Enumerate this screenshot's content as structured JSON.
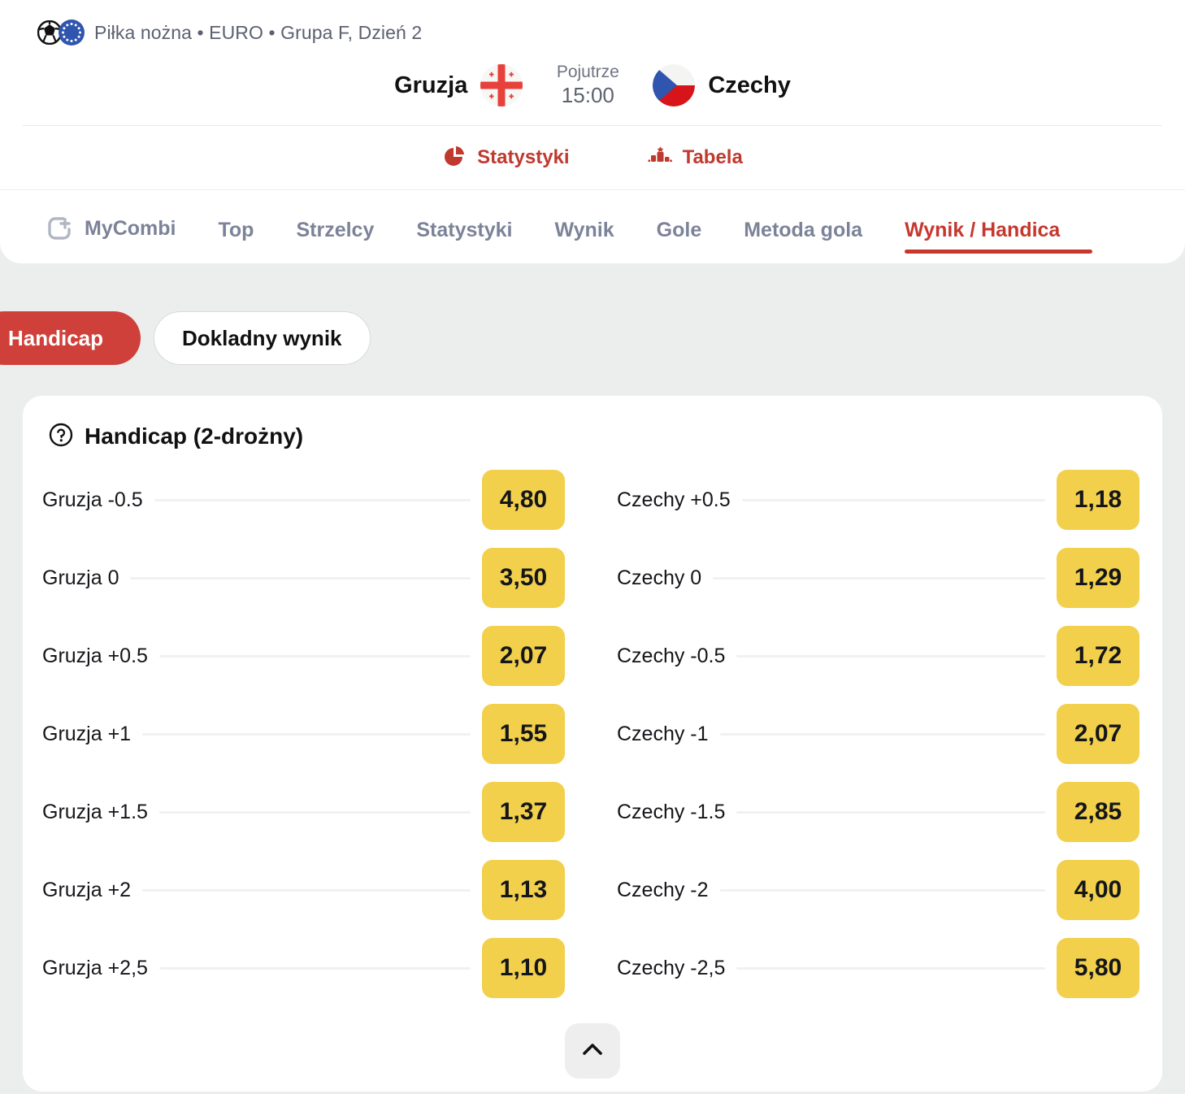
{
  "breadcrumb": {
    "text": "Piłka nożna • EURO • Grupa F, Dzień 2",
    "sport_icon": "soccer-ball-icon",
    "competition_icon": "euro-stars-icon"
  },
  "match": {
    "home_team": "Gruzja",
    "away_team": "Czechy",
    "home_flag": "georgia-flag-icon",
    "away_flag": "czechia-flag-icon",
    "day_label": "Pojutrze",
    "time": "15:00"
  },
  "sub_actions": [
    {
      "label": "Statystyki",
      "icon": "pie-chart-icon"
    },
    {
      "label": "Tabela",
      "icon": "podium-icon"
    }
  ],
  "tabs": [
    {
      "label": "MyCombi",
      "icon": "mycombi-add-icon",
      "active": false
    },
    {
      "label": "Top",
      "active": false
    },
    {
      "label": "Strzelcy",
      "active": false
    },
    {
      "label": "Statystyki",
      "active": false
    },
    {
      "label": "Wynik",
      "active": false
    },
    {
      "label": "Gole",
      "active": false
    },
    {
      "label": "Metoda gola",
      "active": false
    },
    {
      "label": "Wynik / Handica",
      "active": true
    }
  ],
  "filter_pills": [
    {
      "label": "Handicap",
      "selected": true
    },
    {
      "label": "Dokladny wynik",
      "selected": false
    }
  ],
  "market": {
    "title": "Handicap (2-drożny)",
    "help_icon": "question-circle-icon",
    "collapse_icon": "chevron-up-icon",
    "left_column": [
      {
        "label": "Gruzja -0.5",
        "odd": "4,80"
      },
      {
        "label": "Gruzja 0",
        "odd": "3,50"
      },
      {
        "label": "Gruzja +0.5",
        "odd": "2,07"
      },
      {
        "label": "Gruzja +1",
        "odd": "1,55"
      },
      {
        "label": "Gruzja +1.5",
        "odd": "1,37"
      },
      {
        "label": "Gruzja +2",
        "odd": "1,13"
      },
      {
        "label": "Gruzja +2,5",
        "odd": "1,10"
      }
    ],
    "right_column": [
      {
        "label": "Czechy +0.5",
        "odd": "1,18"
      },
      {
        "label": "Czechy 0",
        "odd": "1,29"
      },
      {
        "label": "Czechy -0.5",
        "odd": "1,72"
      },
      {
        "label": "Czechy -1",
        "odd": "2,07"
      },
      {
        "label": "Czechy -1.5",
        "odd": "2,85"
      },
      {
        "label": "Czechy -2",
        "odd": "4,00"
      },
      {
        "label": "Czechy -2,5",
        "odd": "5,80"
      }
    ]
  },
  "colors": {
    "brand_red": "#d0403a",
    "accent_red": "#c0392f",
    "odds_yellow": "#f2d04b",
    "tab_inactive": "#7c8399",
    "page_background": "#eceded"
  }
}
